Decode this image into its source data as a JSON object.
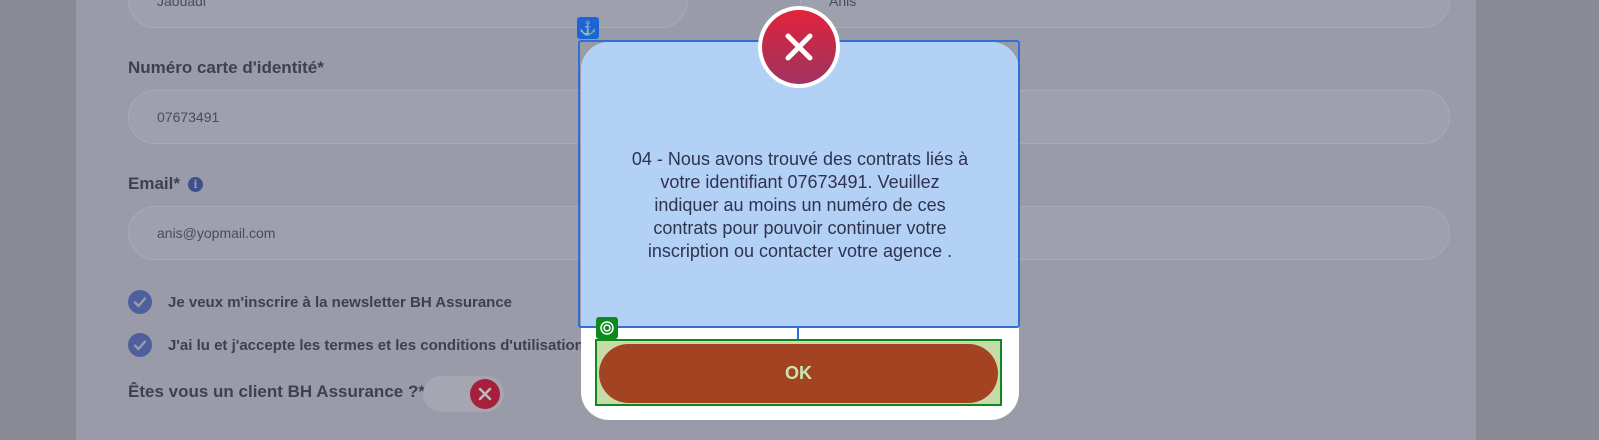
{
  "form": {
    "last_name_value": "Jaouadi",
    "first_name_value": "Anis",
    "id_label": "Numéro carte d'identité*",
    "id_value": "07673491",
    "email_label": "Email*",
    "email_info_icon": "info-icon",
    "email_value": "anis@yopmail.com",
    "newsletter_label": "Je veux m'inscrire à la newsletter BH Assurance",
    "terms_label": "J'ai lu et j'accepte les termes et les conditions d'utilisation",
    "client_label": "Êtes vous un client BH Assurance ?*"
  },
  "modal": {
    "message": "04 - Nous avons trouvé des contrats liés à votre identifiant 07673491. Veuillez indiquer au moins un numéro de ces contrats pour pouvoir continuer votre inscription ou contacter votre agence .",
    "ok_label": "OK",
    "close_icon": "close-icon"
  },
  "colors": {
    "overlay": "#898a94",
    "modal_body": "#b3d0f5",
    "close_red": "#e2233b",
    "ok_button": "#a44322",
    "selection_blue": "#2f6fd6",
    "selection_green": "#0c8a1e"
  }
}
